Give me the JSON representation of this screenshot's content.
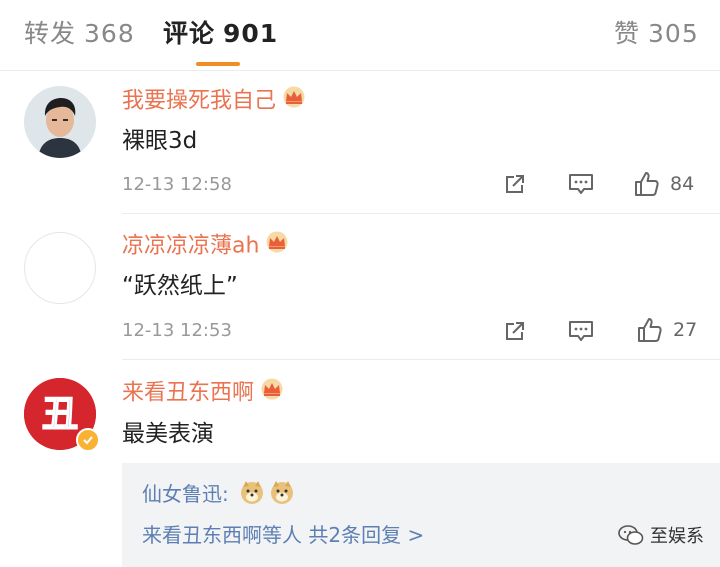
{
  "tabs": {
    "repost": {
      "label": "转发",
      "count": "368"
    },
    "comment": {
      "label": "评论",
      "count": "901"
    },
    "like": {
      "label": "赞",
      "count": "305"
    }
  },
  "comments": [
    {
      "username": "我要操死我自己",
      "text": "裸眼3d",
      "time": "12-13 12:58",
      "likes": "84"
    },
    {
      "username": "凉凉凉凉薄ah",
      "text": "“跃然纸上”",
      "time": "12-13 12:53",
      "likes": "27"
    },
    {
      "username": "来看丑东西啊",
      "text": "最美表演",
      "avatar_char": "丑"
    }
  ],
  "replies": {
    "preview_user": "仙女鲁迅:",
    "summary": "来看丑东西啊等人  共2条回复 >"
  },
  "watermark": {
    "text": "至娱系"
  },
  "colors": {
    "accent": "#f18e20",
    "username": "#eb7350",
    "link": "#5d7fb3"
  }
}
